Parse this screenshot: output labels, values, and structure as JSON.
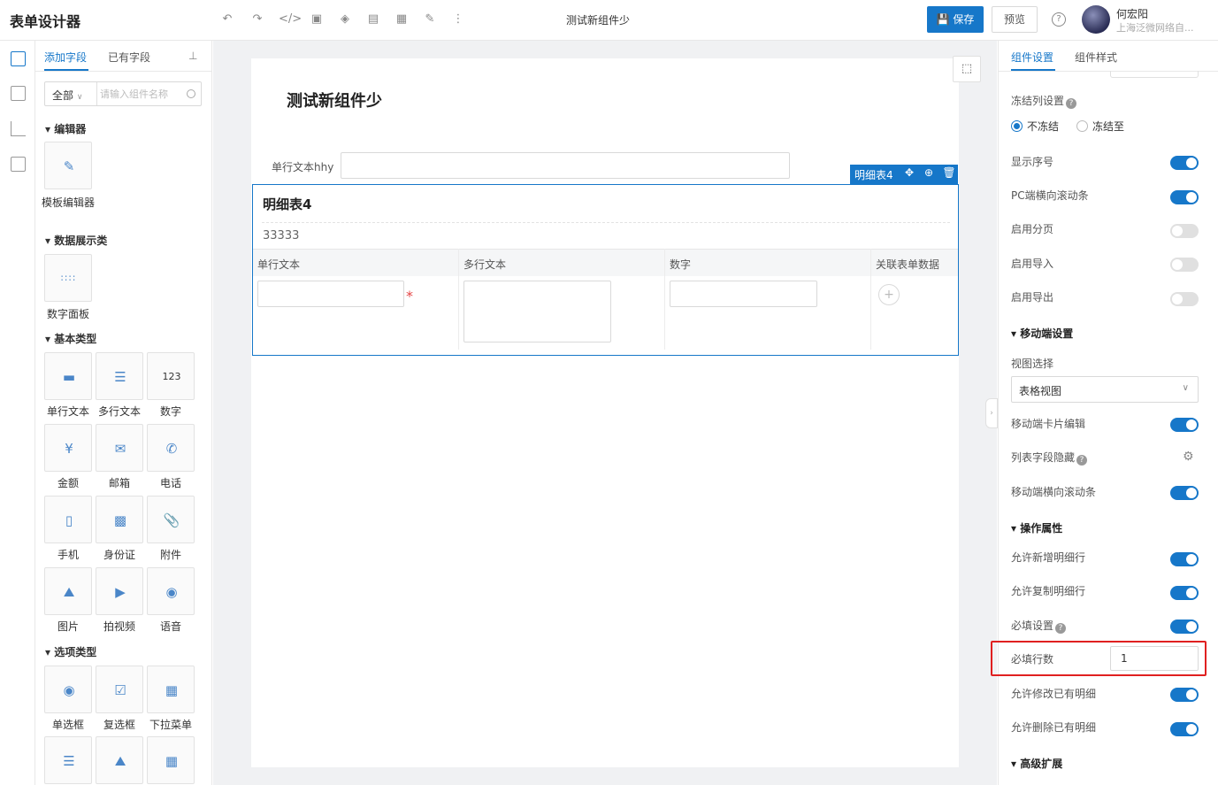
{
  "app_title": "表单设计器",
  "toolbar": {
    "icons": [
      "undo-icon",
      "redo-icon",
      "code-icon",
      "image-icon",
      "layers-icon",
      "database-icon",
      "chart-icon",
      "edit-icon",
      "more-icon"
    ],
    "doc_title": "测试新组件少",
    "save_label": "保存",
    "preview_label": "预览",
    "help_glyph": "?",
    "user_name": "何宏阳",
    "user_org": "上海泛微网络自..."
  },
  "library": {
    "tab_add": "添加字段",
    "tab_existing": "已有字段",
    "category_select": "全部",
    "search_placeholder": "请输入组件名称",
    "groups": {
      "editor": "编辑器",
      "data_display": "数据展示类",
      "basic": "基本类型",
      "options": "选项类型"
    },
    "items": {
      "template_editor": "模板编辑器",
      "number_panel": "数字面板",
      "single_text": "单行文本",
      "multi_text": "多行文本",
      "number": "数字",
      "number_glyph": "123",
      "amount": "金额",
      "email": "邮箱",
      "phone": "电话",
      "mobile": "手机",
      "id_card": "身份证",
      "attachment": "附件",
      "image": "图片",
      "video": "拍视频",
      "voice": "语音",
      "radio": "单选框",
      "checkbox": "复选框",
      "dropdown": "下拉菜单"
    }
  },
  "canvas": {
    "form_title": "测试新组件少",
    "field_label": "单行文本hhy",
    "subtable": {
      "tag": "明细表4",
      "title": "明细表4",
      "description": "33333",
      "columns": [
        "单行文本",
        "多行文本",
        "数字",
        "关联表单数据"
      ],
      "required_star": "*",
      "add_glyph": "+"
    }
  },
  "panel": {
    "tab_settings": "组件设置",
    "tab_style": "组件样式",
    "freeze_label": "冻结列设置",
    "q_glyph": "?",
    "freeze_options": [
      "不冻结",
      "冻结至"
    ],
    "freeze_selected": "不冻结",
    "rows": {
      "show_index": {
        "label": "显示序号",
        "on": true
      },
      "pc_scroll": {
        "label": "PC端横向滚动条",
        "on": true
      },
      "paging": {
        "label": "启用分页",
        "on": false
      },
      "import": {
        "label": "启用导入",
        "on": false
      },
      "export": {
        "label": "启用导出",
        "on": false
      },
      "mobile_card": {
        "label": "移动端卡片编辑",
        "on": true
      },
      "list_hidden": {
        "label": "列表字段隐藏"
      },
      "mobile_scroll": {
        "label": "移动端横向滚动条",
        "on": true
      },
      "allow_add": {
        "label": "允许新增明细行",
        "on": true
      },
      "allow_copy": {
        "label": "允许复制明细行",
        "on": true
      },
      "required_setting": {
        "label": "必填设置",
        "on": true
      },
      "required_rows": {
        "label": "必填行数",
        "value": "1"
      },
      "allow_edit": {
        "label": "允许修改已有明细",
        "on": true
      },
      "allow_delete": {
        "label": "允许删除已有明细",
        "on": true
      }
    },
    "sections": {
      "mobile": "移动端设置",
      "ops": "操作属性",
      "advanced": "高级扩展"
    },
    "view_label": "视图选择",
    "view_value": "表格视图"
  },
  "colors": {
    "accent": "#1677c9",
    "highlight": "#e02020",
    "required": "#e54545"
  }
}
